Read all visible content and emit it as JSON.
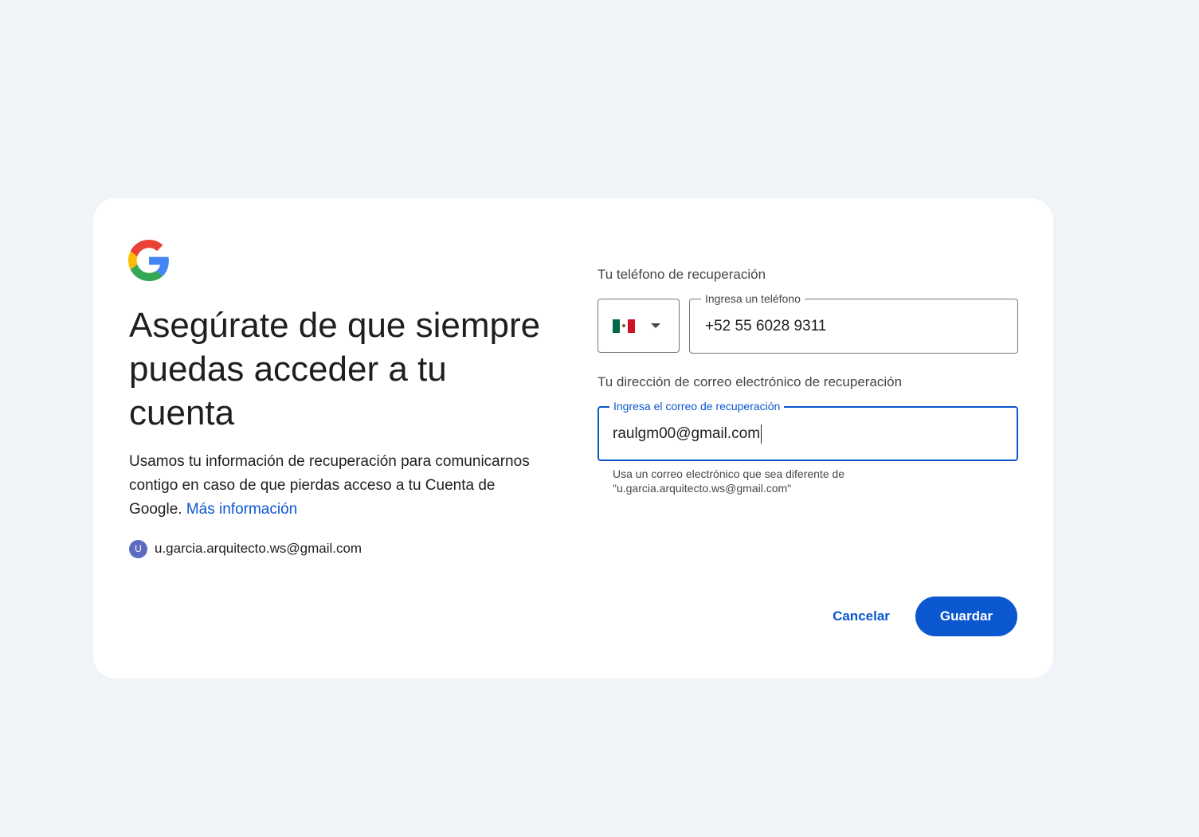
{
  "brand": {
    "logo_icon": "google-g-logo-icon",
    "colors": {
      "blue": "#4285F4",
      "red": "#EA4335",
      "yellow": "#FBBC05",
      "green": "#34A853",
      "primary": "#0b57d0",
      "background": "#f0f4f9"
    }
  },
  "left": {
    "headline": "Asegúrate de que siempre puedas acceder a tu cuenta",
    "description": "Usamos tu información de recuperación para comunicarnos contigo en caso de que pierdas acceso a tu Cuenta de Google.",
    "learn_more": "Más información",
    "account": {
      "avatar_initial": "U",
      "email": "u.garcia.arquitecto.ws@gmail.com"
    }
  },
  "phone": {
    "section_label": "Tu teléfono de recuperación",
    "country_flag_icon": "mexico-flag-icon",
    "dropdown_icon": "caret-down-icon",
    "field_label": "Ingresa un teléfono",
    "value": "+52 55 6028 9311"
  },
  "email": {
    "section_label": "Tu dirección de correo electrónico de recuperación",
    "field_label": "Ingresa el correo de recuperación",
    "value": "raulgm00@gmail.com",
    "helper": "Usa un correo electrónico que sea diferente de \"u.garcia.arquitecto.ws@gmail.com\""
  },
  "actions": {
    "cancel_label": "Cancelar",
    "save_label": "Guardar"
  }
}
